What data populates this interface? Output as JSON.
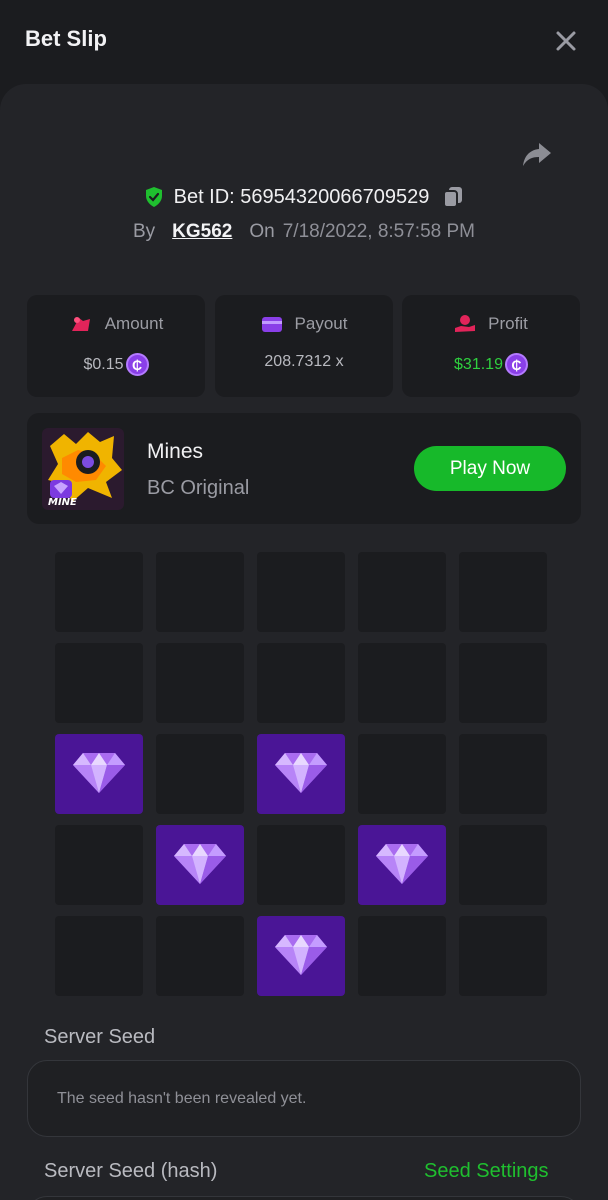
{
  "header": {
    "title": "Bet Slip"
  },
  "bet": {
    "id_label": "Bet ID: 56954320066709529",
    "by_label": "By",
    "user": "KG562",
    "on_label": "On",
    "date": "7/18/2022, 8:57:58 PM"
  },
  "stats": {
    "amount": {
      "label": "Amount",
      "value": "$0.15"
    },
    "payout": {
      "label": "Payout",
      "value": "208.7312 x"
    },
    "profit": {
      "label": "Profit",
      "value": "$31.19"
    }
  },
  "coin_symbol": "₵",
  "game": {
    "name": "Mines",
    "subtitle": "BC Original",
    "thumb_text": "MINE",
    "play_label": "Play Now"
  },
  "board": {
    "rows": 5,
    "cols": 5,
    "cells": [
      "empty",
      "empty",
      "empty",
      "empty",
      "empty",
      "empty",
      "empty",
      "empty",
      "empty",
      "empty",
      "gem",
      "empty",
      "gem",
      "empty",
      "empty",
      "empty",
      "gem",
      "empty",
      "gem",
      "empty",
      "empty",
      "empty",
      "gem",
      "empty",
      "empty"
    ]
  },
  "seeds": {
    "server_seed_label": "Server Seed",
    "server_seed_value": "The seed hasn't been revealed yet.",
    "server_seed_hash_label": "Server Seed (hash)",
    "seed_settings_label": "Seed Settings"
  },
  "colors": {
    "accent_green": "#17b92a",
    "gem_tile": "#4a1596",
    "profit_green": "#2fd03f",
    "coin_purple": "#8a3fe8"
  }
}
